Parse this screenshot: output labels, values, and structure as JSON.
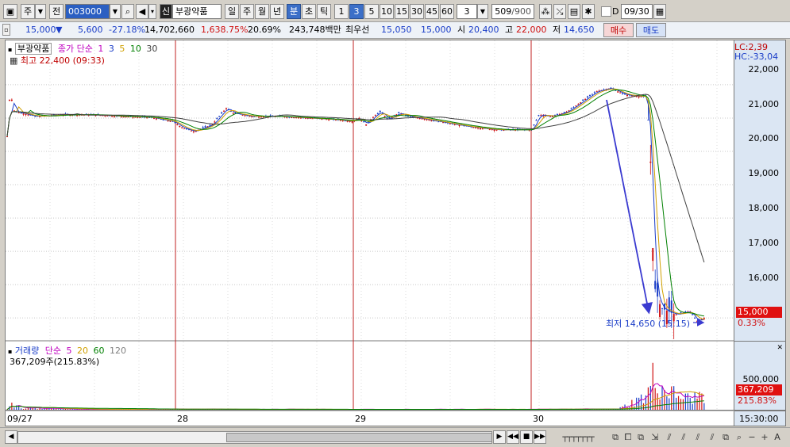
{
  "toolbar": {
    "type_label": "주",
    "prev_label": "전",
    "code": "003000",
    "badge": "신",
    "stock_name": "부광약품",
    "periods": [
      "일",
      "주",
      "월",
      "년",
      "분",
      "초",
      "틱"
    ],
    "selected_period": "분",
    "intervals": [
      "1",
      "3",
      "5",
      "10",
      "15",
      "30",
      "45",
      "60"
    ],
    "selected_interval": "3",
    "interval_value": "3",
    "count": "509",
    "count_max": "/900",
    "date_checkbox_label": "D",
    "date": "09/30"
  },
  "info": {
    "price": "15,000",
    "change": "5,600",
    "change_pct": "-27.18%",
    "volume": "14,702,660",
    "volume_ratio": "1,638.75%",
    "turnover": "20.69%",
    "amount": "243,748백만",
    "best_label": "최우선",
    "ask": "15,050",
    "bid": "15,000",
    "open_label": "시",
    "open": "20,400",
    "high_label": "고",
    "high": "22,000",
    "low_label": "저",
    "low": "14,650",
    "buy_label": "매수",
    "sell_label": "매도"
  },
  "price_panel": {
    "name": "부광약품",
    "legend_prefix": "종가 단순",
    "ma_labels": [
      "1",
      "3",
      "5",
      "10",
      "30"
    ],
    "ma_colors": [
      "#c000c0",
      "#1a3dc8",
      "#d0a000",
      "#008000",
      "#404040"
    ],
    "high_note": "최고 22,400 (09:33)",
    "low_note": "최저 14,650 (15:15)",
    "lc_label": "LC:2,39",
    "hc_label": "HC:-33,04",
    "current_tag": "15,000",
    "current_pct": "0.33%",
    "y_ticks": [
      "22,000",
      "21,000",
      "20,000",
      "19,000",
      "18,000",
      "17,000",
      "16,000"
    ]
  },
  "volume_panel": {
    "name": "거래량",
    "legend_prefix": "단순",
    "ma_labels": [
      "5",
      "20",
      "60",
      "120"
    ],
    "ma_colors": [
      "#c000c0",
      "#d0a000",
      "#008000",
      "#808080"
    ],
    "summary": "367,209주(215.83%)",
    "y_tick": "500,000",
    "current_tag": "367,209",
    "current_pct": "215.83%"
  },
  "xaxis": {
    "labels": [
      "09/27",
      "28",
      "29",
      "30"
    ],
    "time_label": "15:30:00"
  },
  "colors": {
    "up": "#d01010",
    "down": "#1a3dc8",
    "ma1": "#c000c0",
    "ma3": "#1a3dc8",
    "ma5": "#d0a000",
    "ma10": "#008000",
    "ma30": "#404040",
    "accent": "#3c6fc8",
    "annotation_arrow": "#3a3ad0"
  },
  "chart_data": {
    "type": "candlestick",
    "series": [
      {
        "name": "종가 단순 1"
      },
      {
        "name": "종가 단순 3"
      },
      {
        "name": "종가 단순 5"
      },
      {
        "name": "종가 단순 10"
      },
      {
        "name": "종가 단순 30"
      }
    ],
    "x": [
      "09/27",
      "28",
      "29",
      "30"
    ],
    "ylim": [
      14650,
      22400
    ],
    "close_path": [
      [
        0.0,
        20450
      ],
      [
        0.004,
        21800
      ],
      [
        0.01,
        21200
      ],
      [
        0.02,
        21150
      ],
      [
        0.04,
        21050
      ],
      [
        0.08,
        21100
      ],
      [
        0.12,
        21100
      ],
      [
        0.16,
        21050
      ],
      [
        0.2,
        21020
      ],
      [
        0.23,
        20900
      ],
      [
        0.245,
        20700
      ],
      [
        0.26,
        20600
      ],
      [
        0.285,
        20800
      ],
      [
        0.305,
        21300
      ],
      [
        0.315,
        21150
      ],
      [
        0.34,
        21050
      ],
      [
        0.38,
        21050
      ],
      [
        0.42,
        21000
      ],
      [
        0.46,
        20950
      ],
      [
        0.48,
        20900
      ],
      [
        0.49,
        21000
      ],
      [
        0.5,
        20800
      ],
      [
        0.51,
        21050
      ],
      [
        0.52,
        21200
      ],
      [
        0.53,
        20950
      ],
      [
        0.545,
        21150
      ],
      [
        0.56,
        21050
      ],
      [
        0.6,
        20900
      ],
      [
        0.64,
        20750
      ],
      [
        0.68,
        20650
      ],
      [
        0.72,
        20650
      ],
      [
        0.73,
        20650
      ],
      [
        0.74,
        21100
      ],
      [
        0.76,
        21050
      ],
      [
        0.78,
        21200
      ],
      [
        0.8,
        21500
      ],
      [
        0.82,
        21800
      ],
      [
        0.84,
        21900
      ],
      [
        0.86,
        21700
      ],
      [
        0.88,
        21650
      ],
      [
        0.89,
        21650
      ],
      [
        0.895,
        20000
      ],
      [
        0.9,
        16000
      ],
      [
        0.91,
        15300
      ],
      [
        0.93,
        15100
      ],
      [
        0.95,
        15200
      ],
      [
        0.96,
        14900
      ],
      [
        0.97,
        15000
      ]
    ],
    "volume_path": [
      [
        0.0,
        5000
      ],
      [
        0.006,
        300000
      ],
      [
        0.01,
        80000
      ],
      [
        0.02,
        40000
      ],
      [
        0.1,
        10000
      ],
      [
        0.3,
        12000
      ],
      [
        0.5,
        8000
      ],
      [
        0.7,
        10000
      ],
      [
        0.85,
        15000
      ],
      [
        0.89,
        300000
      ],
      [
        0.895,
        550000
      ],
      [
        0.9,
        800000
      ],
      [
        0.91,
        500000
      ],
      [
        0.93,
        350000
      ],
      [
        0.95,
        250000
      ],
      [
        0.97,
        367209
      ]
    ]
  }
}
